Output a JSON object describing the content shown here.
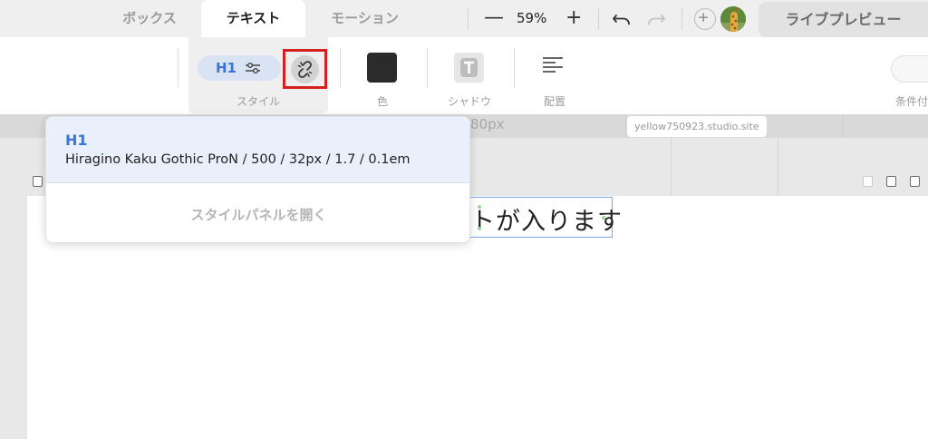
{
  "tabs": [
    {
      "label": "ボックス",
      "active": false
    },
    {
      "label": "テキスト",
      "active": true
    },
    {
      "label": "モーション",
      "active": false
    }
  ],
  "zoom": {
    "minus": "—",
    "level": "59%",
    "plus": "+"
  },
  "preview_label": "ライブプレビュー",
  "toolbar": {
    "style_tag": "H1",
    "style_label": "スタイル",
    "color_label": "色",
    "shadow_label": "シャドウ",
    "align_label": "配置",
    "condition_label": "条件付"
  },
  "canvas": {
    "ruler_label": "80px",
    "site_url": "yellow750923.studio.site",
    "heading_text": "トが入ります"
  },
  "dropdown": {
    "option_name": "H1",
    "option_spec": "Hiragino Kaku Gothic ProN / 500 / 32px / 1.7 / 0.1em",
    "open_panel_label": "スタイルパネルを開く"
  },
  "colors": {
    "accent": "#3b73d8",
    "highlight_border": "#d42020",
    "swatch": "#2b2b2b",
    "selection": "#7aa8f0"
  },
  "icons": [
    "sliders-icon",
    "unlink-icon",
    "align-left-icon",
    "undo-icon",
    "redo-icon",
    "plus-icon",
    "trash-icon",
    "add-frame-icon"
  ]
}
